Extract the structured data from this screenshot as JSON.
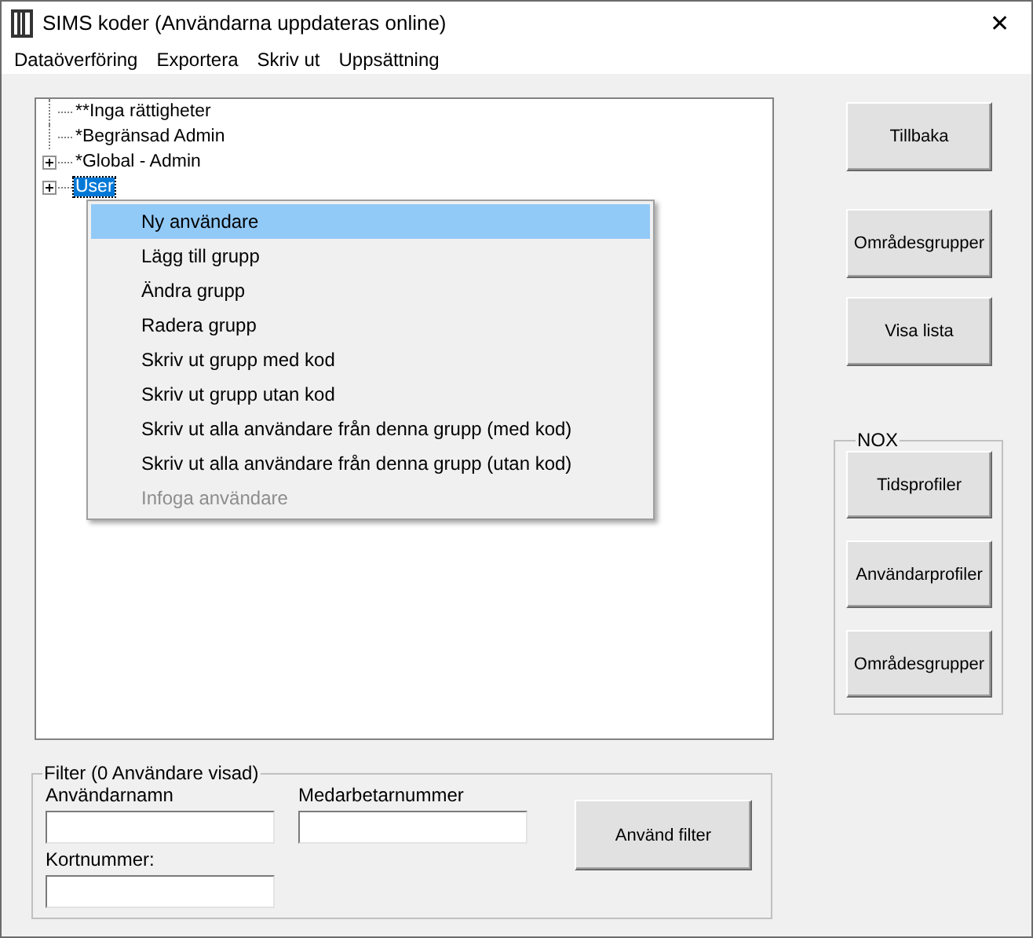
{
  "window": {
    "title": "SIMS koder (Användarna uppdateras online)",
    "close": "✕"
  },
  "menu": [
    "Dataöverföring",
    "Exportera",
    "Skriv ut",
    "Uppsättning"
  ],
  "tree": [
    {
      "label": "**Inga rättigheter",
      "expandable": false,
      "selected": false
    },
    {
      "label": "*Begränsad Admin",
      "expandable": false,
      "selected": false
    },
    {
      "label": "*Global - Admin",
      "expandable": true,
      "selected": false
    },
    {
      "label": "User",
      "expandable": true,
      "selected": true
    }
  ],
  "context_menu": [
    {
      "label": "Ny användare",
      "selected": true,
      "disabled": false
    },
    {
      "label": "Lägg till grupp",
      "selected": false,
      "disabled": false
    },
    {
      "label": "Ändra grupp",
      "selected": false,
      "disabled": false
    },
    {
      "label": "Radera grupp",
      "selected": false,
      "disabled": false
    },
    {
      "label": "Skriv ut grupp med kod",
      "selected": false,
      "disabled": false
    },
    {
      "label": "Skriv ut grupp utan kod",
      "selected": false,
      "disabled": false
    },
    {
      "label": "Skriv ut alla användare från denna grupp (med kod)",
      "selected": false,
      "disabled": false
    },
    {
      "label": "Skriv ut alla användare från denna grupp (utan kod)",
      "selected": false,
      "disabled": false
    },
    {
      "label": "Infoga användare",
      "selected": false,
      "disabled": true
    }
  ],
  "buttons": [
    "Tillbaka",
    "Områdesgrupper",
    "Visa lista"
  ],
  "nox": {
    "title": "NOX",
    "buttons": [
      "Tidsprofiler",
      "Användarprofiler",
      "Områdesgrupper"
    ]
  },
  "filter": {
    "title": "Filter (0 Användare visad)",
    "fields": [
      {
        "label": "Användarnamn"
      },
      {
        "label": "Medarbetarnummer"
      },
      {
        "label": "Kortnummer:"
      }
    ],
    "button": "Använd filter"
  }
}
